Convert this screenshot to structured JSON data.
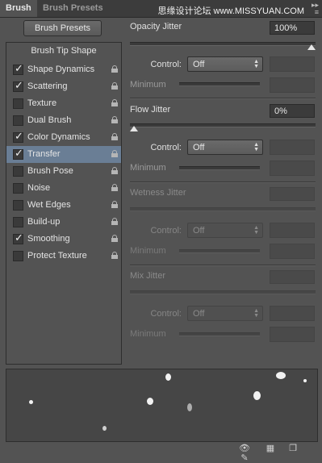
{
  "tabs": [
    {
      "label": "Brush"
    },
    {
      "label": "Brush Presets"
    }
  ],
  "watermark": "思缘设计论坛 www.MISSYUAN.COM",
  "panel_menu_icon": "double-chevron-right-icon",
  "brush_presets_button": "Brush Presets",
  "left_list": {
    "header": "Brush Tip Shape",
    "items": [
      {
        "label": "Shape Dynamics",
        "checked": true,
        "check": "✓"
      },
      {
        "label": "Scattering",
        "checked": true,
        "check": "✓"
      },
      {
        "label": "Texture",
        "checked": false,
        "check": ""
      },
      {
        "label": "Dual Brush",
        "checked": false,
        "check": ""
      },
      {
        "label": "Color Dynamics",
        "checked": true,
        "check": "✓"
      },
      {
        "label": "Transfer",
        "checked": true,
        "check": "✓",
        "selected": true
      },
      {
        "label": "Brush Pose",
        "checked": false,
        "check": ""
      },
      {
        "label": "Noise",
        "checked": false,
        "check": ""
      },
      {
        "label": "Wet Edges",
        "checked": false,
        "check": ""
      },
      {
        "label": "Build-up",
        "checked": false,
        "check": ""
      },
      {
        "label": "Smoothing",
        "checked": true,
        "check": "✓"
      },
      {
        "label": "Protect Texture",
        "checked": false,
        "check": ""
      }
    ]
  },
  "opacity_jitter": {
    "label": "Opacity Jitter",
    "value": "100%",
    "slider_fraction": 1.0,
    "control_label": "Control:",
    "control_value": "Off",
    "minimum_label": "Minimum"
  },
  "flow_jitter": {
    "label": "Flow Jitter",
    "value": "0%",
    "slider_fraction": 0.0,
    "control_label": "Control:",
    "control_value": "Off",
    "minimum_label": "Minimum"
  },
  "wetness_jitter": {
    "label": "Wetness Jitter",
    "control_label": "Control:",
    "control_value": "Off",
    "minimum_label": "Minimum"
  },
  "mix_jitter": {
    "label": "Mix Jitter",
    "control_label": "Control:",
    "control_value": "Off",
    "minimum_label": "Minimum"
  },
  "bottom_icons": [
    "toggle-live-tip-icon",
    "grid-icon",
    "new-preset-icon"
  ],
  "colors": {
    "panel": "#535353",
    "selected_row": "#6a7e95",
    "tabbar": "#3c3c3c"
  }
}
